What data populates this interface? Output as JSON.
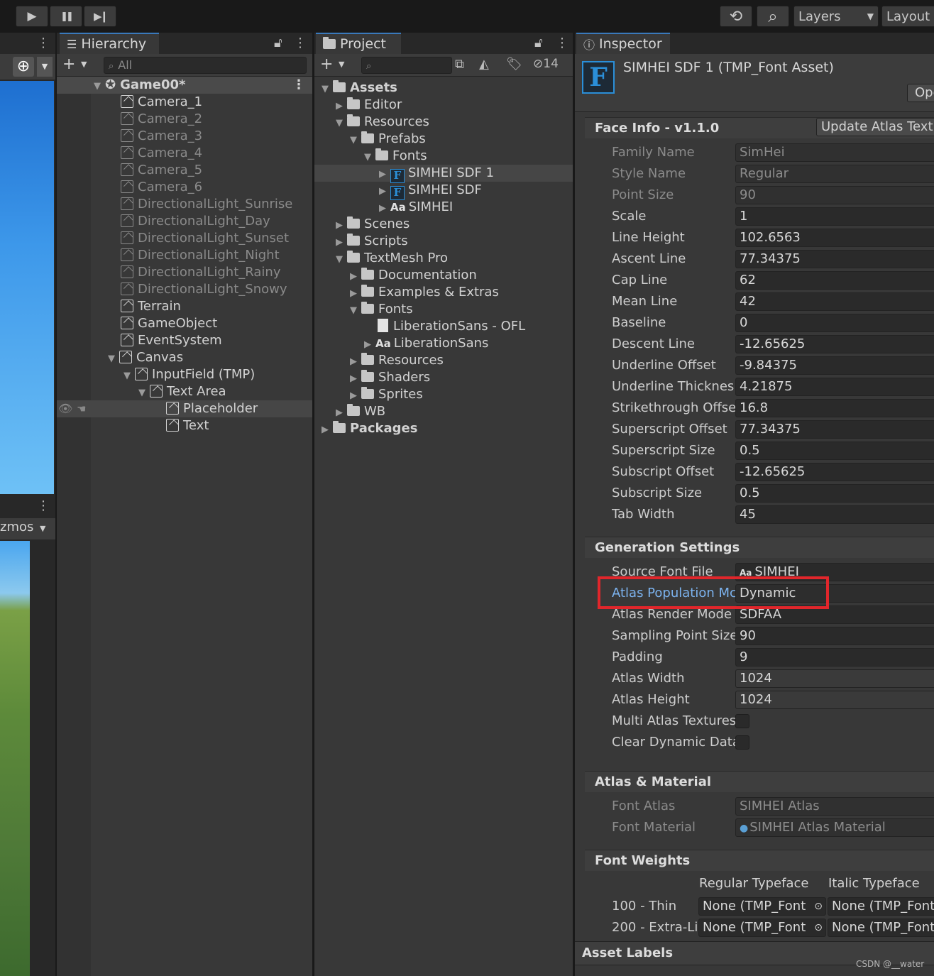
{
  "toolbar": {
    "play": "▶",
    "pause": "❚❚",
    "step": "▶❙",
    "history": "⟲",
    "search": "⌕",
    "layers_label": "Layers",
    "layout_label": "Layout"
  },
  "scene_fragment": {
    "gizmos_label": "zmos"
  },
  "hierarchy": {
    "tab_label": "Hierarchy",
    "search_placeholder": "All",
    "root": "Game00*",
    "items": [
      {
        "label": "Camera_1"
      },
      {
        "label": "Camera_2"
      },
      {
        "label": "Camera_3"
      },
      {
        "label": "Camera_4"
      },
      {
        "label": "Camera_5"
      },
      {
        "label": "Camera_6"
      },
      {
        "label": "DirectionalLight_Sunrise"
      },
      {
        "label": "DirectionalLight_Day"
      },
      {
        "label": "DirectionalLight_Sunset"
      },
      {
        "label": "DirectionalLight_Night"
      },
      {
        "label": "DirectionalLight_Rainy"
      },
      {
        "label": "DirectionalLight_Snowy"
      },
      {
        "label": "Terrain"
      },
      {
        "label": "GameObject"
      },
      {
        "label": "EventSystem"
      },
      {
        "label": "Canvas"
      },
      {
        "label": "InputField (TMP)"
      },
      {
        "label": "Text Area"
      },
      {
        "label": "Placeholder"
      },
      {
        "label": "Text"
      }
    ]
  },
  "project": {
    "tab_label": "Project",
    "hidden_count": "14",
    "items": [
      {
        "label": "Assets"
      },
      {
        "label": "Editor"
      },
      {
        "label": "Resources"
      },
      {
        "label": "Prefabs"
      },
      {
        "label": "Fonts"
      },
      {
        "label": "SIMHEI SDF 1"
      },
      {
        "label": "SIMHEI SDF"
      },
      {
        "label": "SIMHEI"
      },
      {
        "label": "Scenes"
      },
      {
        "label": "Scripts"
      },
      {
        "label": "TextMesh Pro"
      },
      {
        "label": "Documentation"
      },
      {
        "label": "Examples & Extras"
      },
      {
        "label": "Fonts"
      },
      {
        "label": "LiberationSans - OFL"
      },
      {
        "label": "LiberationSans"
      },
      {
        "label": "Resources"
      },
      {
        "label": "Shaders"
      },
      {
        "label": "Sprites"
      },
      {
        "label": "WB"
      },
      {
        "label": "Packages"
      }
    ]
  },
  "inspector": {
    "tab_label": "Inspector",
    "asset_title": "SIMHEI SDF 1 (TMP_Font Asset)",
    "open_button": "Ope",
    "face_info": {
      "header": "Face Info - v1.1.0",
      "update_button": "Update Atlas Textu",
      "fields": [
        {
          "label": "Family Name",
          "value": "SimHei"
        },
        {
          "label": "Style Name",
          "value": "Regular"
        },
        {
          "label": "Point Size",
          "value": "90"
        },
        {
          "label": "Scale",
          "value": "1"
        },
        {
          "label": "Line Height",
          "value": "102.6563"
        },
        {
          "label": "Ascent Line",
          "value": "77.34375"
        },
        {
          "label": "Cap Line",
          "value": "62"
        },
        {
          "label": "Mean Line",
          "value": "42"
        },
        {
          "label": "Baseline",
          "value": "0"
        },
        {
          "label": "Descent Line",
          "value": "-12.65625"
        },
        {
          "label": "Underline Offset",
          "value": "-9.84375"
        },
        {
          "label": "Underline Thicknes",
          "value": "4.21875"
        },
        {
          "label": "Strikethrough Offse",
          "value": "16.8"
        },
        {
          "label": "Superscript Offset",
          "value": "77.34375"
        },
        {
          "label": "Superscript Size",
          "value": "0.5"
        },
        {
          "label": "Subscript Offset",
          "value": "-12.65625"
        },
        {
          "label": "Subscript Size",
          "value": "0.5"
        },
        {
          "label": "Tab Width",
          "value": "45"
        }
      ]
    },
    "generation": {
      "header": "Generation Settings",
      "fields": [
        {
          "label": "Source Font File",
          "value": "SIMHEI"
        },
        {
          "label": "Atlas Population Mc",
          "value": "Dynamic"
        },
        {
          "label": "Atlas Render Mode",
          "value": "SDFAA"
        },
        {
          "label": "Sampling Point Size",
          "value": "90"
        },
        {
          "label": "Padding",
          "value": "9"
        },
        {
          "label": "Atlas Width",
          "value": "1024"
        },
        {
          "label": "Atlas Height",
          "value": "1024"
        },
        {
          "label": "Multi Atlas Textures",
          "value": ""
        },
        {
          "label": "Clear Dynamic Data",
          "value": ""
        }
      ]
    },
    "atlas_material": {
      "header": "Atlas & Material",
      "fields": [
        {
          "label": "Font Atlas",
          "value": "SIMHEI Atlas"
        },
        {
          "label": "Font Material",
          "value": "SIMHEI Atlas Material"
        }
      ]
    },
    "font_weights": {
      "header": "Font Weights",
      "col_regular": "Regular Typeface",
      "col_italic": "Italic Typeface",
      "rows": [
        {
          "label": "100 - Thin",
          "regular": "None (TMP_Font",
          "italic": "None (TMP_Font"
        },
        {
          "label": "200 - Extra-Li",
          "regular": "None (TMP_Font",
          "italic": "None (TMP_Font"
        }
      ]
    },
    "asset_labels": "Asset Labels",
    "highlight_color": "#e0262b"
  },
  "watermark": "CSDN @__water"
}
